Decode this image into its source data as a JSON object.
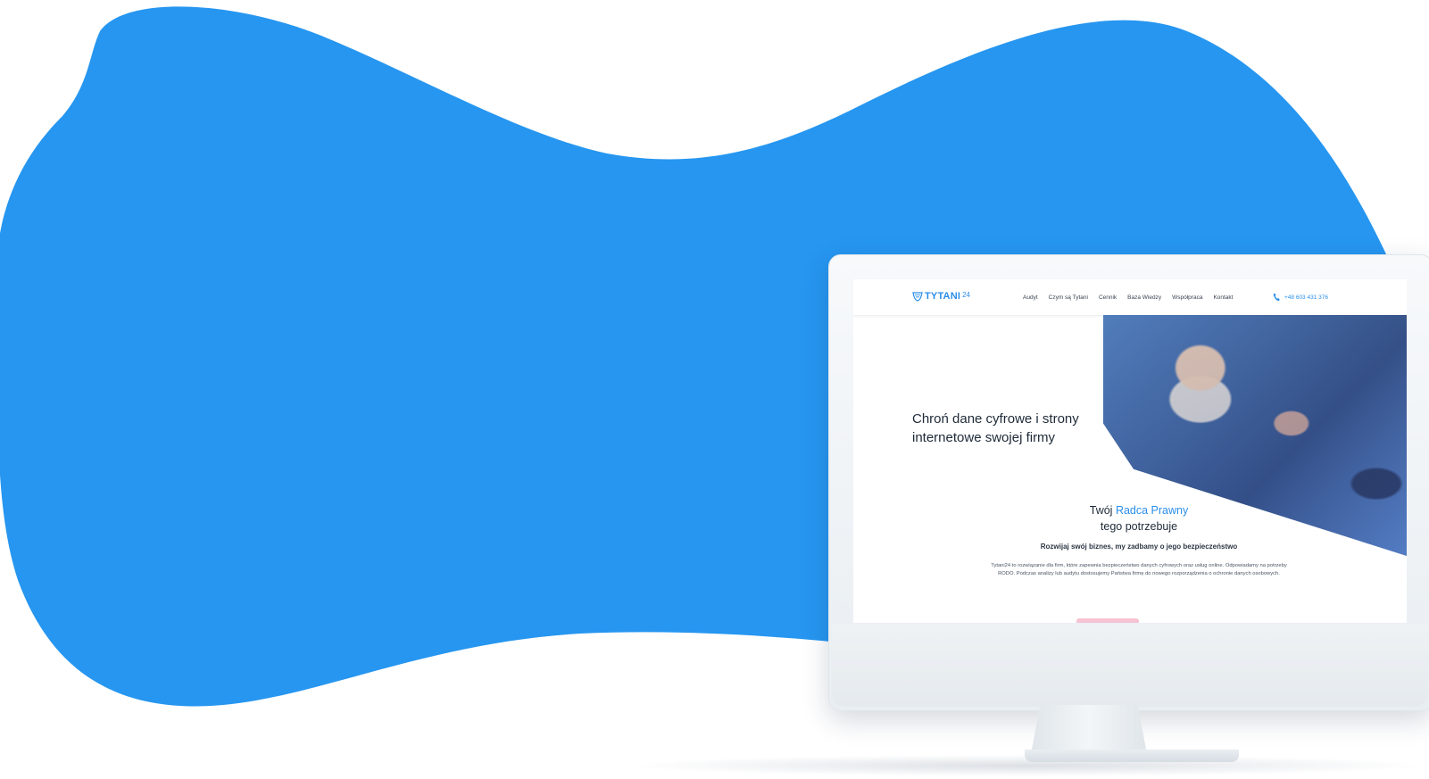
{
  "colors": {
    "blob": "#2696f0",
    "accent": "#2a8ee8",
    "heading": "#1e2a38"
  },
  "site": {
    "logo": {
      "text": "TYTANI",
      "suffix": "24",
      "icon": "shield-icon"
    },
    "nav": {
      "items": [
        {
          "label": "Audyt"
        },
        {
          "label": "Czym są Tytani"
        },
        {
          "label": "Cennik"
        },
        {
          "label": "Baza Wiedzy"
        },
        {
          "label": "Współpraca"
        },
        {
          "label": "Kontakt"
        }
      ],
      "phone": "+48 603 431 376",
      "phone_icon": "phone-icon"
    },
    "hero": {
      "title": "Chroń dane cyfrowe i strony internetowe swojej firmy",
      "image": "handshake-photo"
    },
    "tagline": {
      "part1": "Twój ",
      "accent": "Radca Prawny",
      "part2": "tego potrzebuje"
    },
    "subtitle": "Rozwijaj swój biznes, my zadbamy o jego bezpieczeństwo",
    "description": "Tytani24 to rozwiązanie dla firm, które zapewnia bezpieczeństwo danych cyfrowych oraz usług online. Odpowiadamy na potrzeby RODO. Podczas analizy lub audytu dostosujemy Państwa firmę do nowego rozporządzenia o ochronie danych osobowych."
  }
}
